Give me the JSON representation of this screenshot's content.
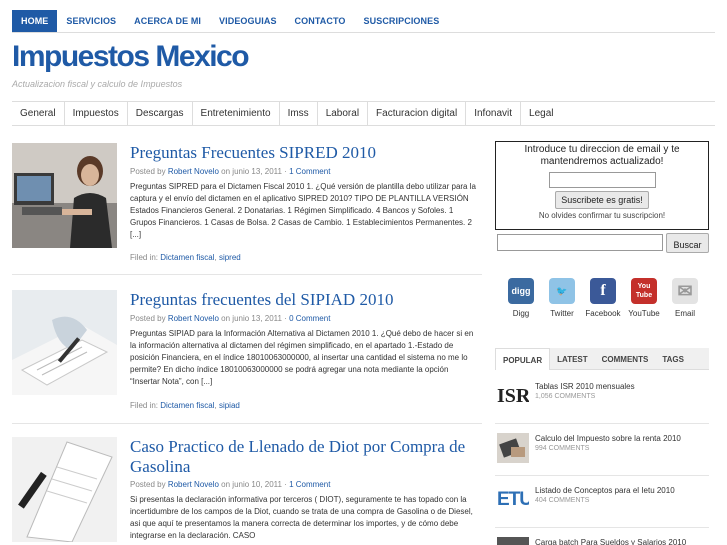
{
  "topnav": [
    "HOME",
    "SERVICIOS",
    "ACERCA DE MI",
    "VIDEOGUIAS",
    "CONTACTO",
    "SUSCRIPCIONES"
  ],
  "site": {
    "title": "Impuestos Mexico",
    "tagline": "Actualizacion fiscal y calculo de Impuestos"
  },
  "categories": [
    "General",
    "Impuestos",
    "Descargas",
    "Entretenimiento",
    "Imss",
    "Laboral",
    "Facturacion digital",
    "Infonavit",
    "Legal"
  ],
  "posts": [
    {
      "title": "Preguntas Frecuentes SIPRED 2010",
      "by": "Posted by ",
      "author": "Robert Novelo",
      "date": " on junio 13, 2011 · ",
      "comments": "1 Comment",
      "excerpt": "Preguntas SIPRED para el Dictamen Fiscal 2010 1. ¿Qué versión de plantilla debo utilizar para la captura y el envío del dictamen en el aplicativo SIPRED 2010? TIPO DE PLANTILLA VERSIÓN  Estados Financieros General. 2  Donatarias. 1  Régimen Simplificado. 4  Bancos y Sofoles. 1  Grupos Financieros. 1  Casas de Bolsa. 2  Casas de Cambio. 1  Establecimientos Permanentes. 2  [...]",
      "filed_label": "Filed in: ",
      "filed": [
        "Dictamen fiscal",
        "sipred"
      ]
    },
    {
      "title": "Preguntas frecuentes del SIPIAD 2010",
      "by": "Posted by ",
      "author": "Robert Novelo",
      "date": " on junio 13, 2011 · ",
      "comments": "0 Comment",
      "excerpt": "Preguntas SIPIAD para la Información Alternativa al Dictamen 2010 1. ¿Qué debo de hacer si en la información alternativa al dictamen del régimen simplificado, en el apartado 1.-Estado de posición Financiera, en el índice 18010063000000, al insertar una cantidad el sistema no me lo permite? En dicho índice 18010063000000 se podrá agregar una nota mediante la opción “Insertar Nota”, con [...]",
      "filed_label": "Filed in: ",
      "filed": [
        "Dictamen fiscal",
        "sipiad"
      ]
    },
    {
      "title": "Caso Practico de Llenado de Diot por Compra de Gasolina",
      "by": "Posted by ",
      "author": "Robert Novelo",
      "date": " on junio 10, 2011 · ",
      "comments": "1 Comment",
      "excerpt": "Si presentas la declaración informativa por terceros ( DIOT), seguramente te has topado con la incertidumbre de los campos de la Diot, cuando se trata de una compra de Gasolina o de Diesel, asi que aquí te presentamos la manera correcta de determinar los importes, y de cómo debe integrarse en la declaración.     CASO"
    }
  ],
  "subscribe": {
    "text": "Introduce tu direccion de email y te mantendremos actualizado!",
    "button": "Suscribete es gratis!",
    "note": "No olvides confirmar tu suscripcion!"
  },
  "search": {
    "button": "Buscar"
  },
  "social": [
    {
      "label": "Digg",
      "icon": "digg-icon",
      "glyph": "digg",
      "color": "#3b6aa0"
    },
    {
      "label": "Twitter",
      "icon": "twitter-icon",
      "glyph": "🐦",
      "color": "#8fc3e6"
    },
    {
      "label": "Facebook",
      "icon": "facebook-icon",
      "glyph": "f",
      "color": "#3b5998"
    },
    {
      "label": "YouTube",
      "icon": "youtube-icon",
      "glyph": "You Tube",
      "color": "#c4302b"
    },
    {
      "label": "Email",
      "icon": "email-icon",
      "glyph": "✉",
      "color": "#cfcfcf"
    }
  ],
  "tabs": [
    "POPULAR",
    "LATEST",
    "COMMENTS",
    "TAGS"
  ],
  "popular": [
    {
      "title": "Tablas ISR 2010 mensuales",
      "count": "1,056 COMMENTS",
      "thumb": "ISR"
    },
    {
      "title": "Calculo del Impuesto sobre la renta 2010",
      "count": "994 COMMENTS",
      "thumb": ""
    },
    {
      "title": "Listado de Conceptos para el Ietu 2010",
      "count": "404 COMMENTS",
      "thumb": "ETU"
    },
    {
      "title": "Carga batch Para Sueldos y Salarios 2010",
      "count": "",
      "thumb": ""
    }
  ]
}
